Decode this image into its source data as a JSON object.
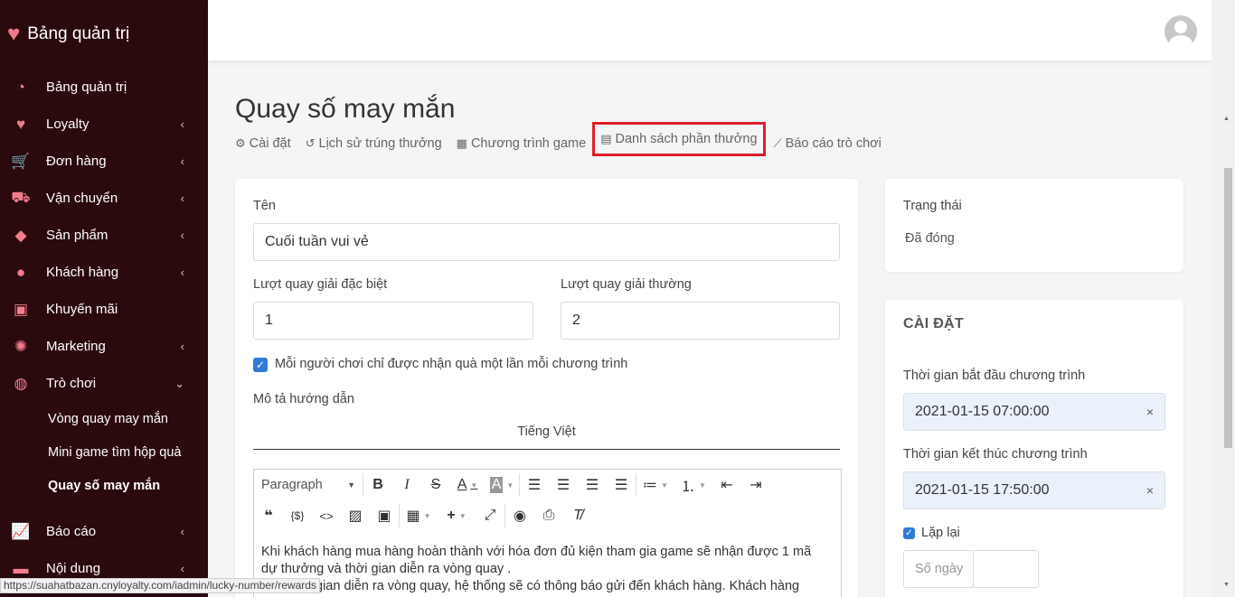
{
  "brand": {
    "title": "Bảng quản trị"
  },
  "sidebar": {
    "items": [
      {
        "label": "Bảng quản trị",
        "icon": "dashboard-icon",
        "chevron": ""
      },
      {
        "label": "Loyalty",
        "icon": "heart-icon",
        "chevron": "‹"
      },
      {
        "label": "Đơn hàng",
        "icon": "cart-icon",
        "chevron": "‹"
      },
      {
        "label": "Vận chuyển",
        "icon": "truck-icon",
        "chevron": "‹"
      },
      {
        "label": "Sản phẩm",
        "icon": "tag-icon",
        "chevron": "‹"
      },
      {
        "label": "Khách hàng",
        "icon": "user-icon",
        "chevron": "‹"
      },
      {
        "label": "Khuyến mãi",
        "icon": "gift-icon",
        "chevron": ""
      },
      {
        "label": "Marketing",
        "icon": "bulb-icon",
        "chevron": "‹"
      },
      {
        "label": "Trò chơi",
        "icon": "gamepad-icon",
        "chevron": "⌄"
      }
    ],
    "subitems": [
      "Vòng quay may mắn",
      "Mini game tìm hộp quà",
      "Quay số may mắn"
    ],
    "tail": [
      {
        "label": "Báo cáo",
        "icon": "chart-icon",
        "chevron": "‹"
      },
      {
        "label": "Nội dung",
        "icon": "content-icon",
        "chevron": "‹"
      }
    ]
  },
  "page": {
    "title": "Quay số may mắn"
  },
  "tabs": [
    {
      "label": "Cài đặt",
      "icon": "gear-icon"
    },
    {
      "label": "Lịch sử trúng thưởng",
      "icon": "history-icon"
    },
    {
      "label": "Chương trình game",
      "icon": "calendar-icon"
    },
    {
      "label": "Danh sách phần thưởng",
      "icon": "list-icon"
    },
    {
      "label": "Báo cáo trò chơi",
      "icon": "line-chart-icon"
    }
  ],
  "form": {
    "name_label": "Tên",
    "name_value": "Cuối tuần vui vẻ",
    "special_label": "Lượt quay giải đặc biệt",
    "special_value": "1",
    "normal_label": "Lượt quay giải thường",
    "normal_value": "2",
    "once_label": "Mỗi người chơi chỉ được nhận quà một lần mỗi chương trình",
    "desc_label": "Mô tả hướng dẫn",
    "lang": "Tiếng Việt",
    "paragraph": "Paragraph",
    "desc_line1": "Khi khách hàng mua hàng hoàn thành với hóa đơn đủ kiện tham gia game sẽ nhận được 1 mã",
    "desc_line2": "dự thưởng và thời gian diễn ra vòng quay .",
    "desc_line3": "gian diễn ra vòng quay, hệ thống sẽ có thông báo gửi đến khách hàng. Khách hàng"
  },
  "status_card": {
    "label": "Trạng thái",
    "value": "Đã đóng"
  },
  "settings": {
    "title": "CÀI ĐẶT",
    "start_label": "Thời gian bắt đầu chương trình",
    "start_value": "2021-01-15 07:00:00",
    "end_label": "Thời gian kết thúc chương trình",
    "end_value": "2021-01-15 17:50:00",
    "repeat_label": "Lặp lại",
    "days_placeholder": "Số ngày"
  },
  "statusbar": {
    "url": "https://suahatbazan.cnyloyalty.com/iadmin/lucky-number/rewards"
  },
  "colors": {
    "sidebar_bg": "#2b0a0e",
    "accent_icon": "#f37d8c",
    "highlight": "#e01e2b",
    "checkbox": "#2f7bd6"
  }
}
